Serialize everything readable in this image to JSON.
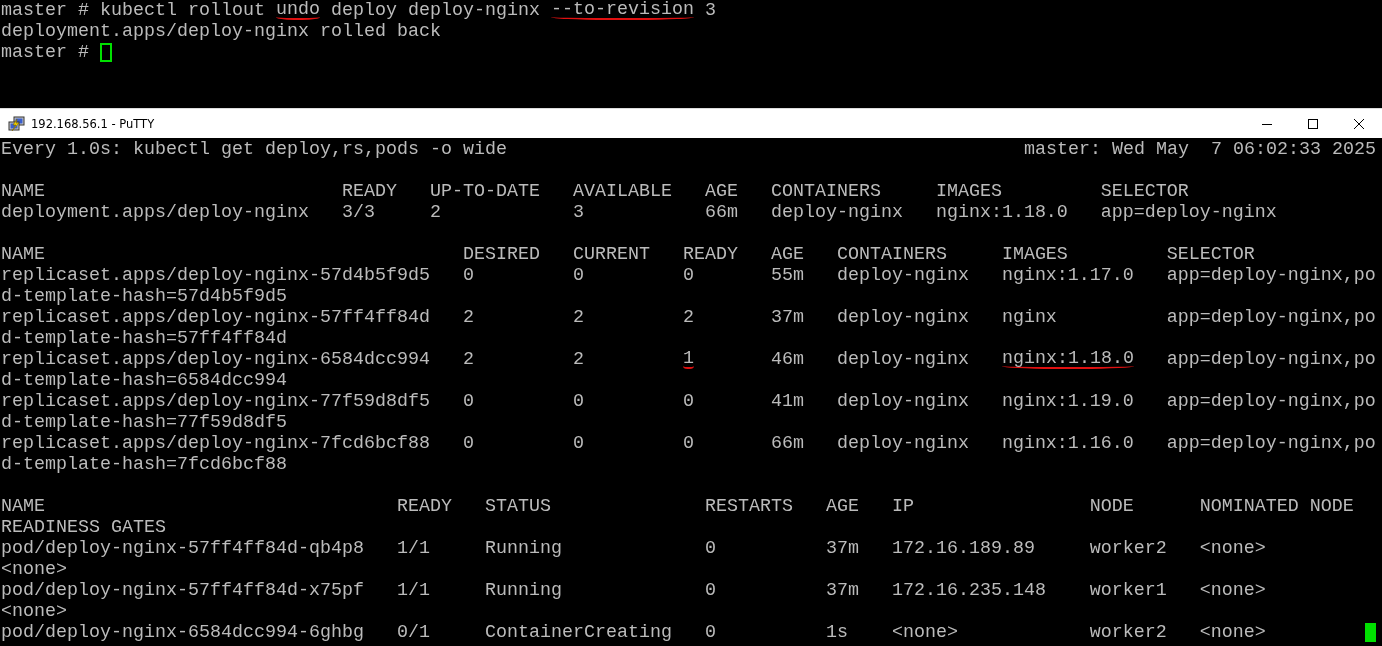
{
  "upper_terminal": {
    "lines": [
      {
        "parts": [
          {
            "text": "master # kubectl rollout ",
            "underlined": false
          },
          {
            "text": "undo",
            "underlined": true
          },
          {
            "text": " deploy deploy-nginx ",
            "underlined": false
          },
          {
            "text": "--to-revision",
            "underlined": true
          },
          {
            "text": " 3",
            "underlined": false
          }
        ]
      },
      {
        "text": "deployment.apps/deploy-nginx rolled back"
      },
      {
        "text": "master # ",
        "cursor": {
          "kind": "hollow"
        }
      }
    ]
  },
  "window": {
    "title": "192.168.56.1 - PuTTY"
  },
  "terminal": {
    "header_left": "Every 1.0s: kubectl get deploy,rs,pods -o wide",
    "header_right": "master: Wed May  7 06:02:33 2025",
    "sections": [
      {
        "lines": [
          {
            "text": "NAME                           READY   UP-TO-DATE   AVAILABLE   AGE   CONTAINERS     IMAGES         SELECTOR"
          },
          {
            "text": "deployment.apps/deploy-nginx   3/3     2            3           66m   deploy-nginx   nginx:1.18.0   app=deploy-nginx"
          }
        ]
      },
      {
        "lines": [
          {
            "text": "NAME                                      DESIRED   CURRENT   READY   AGE   CONTAINERS     IMAGES         SELECTOR"
          },
          {
            "text": "replicaset.apps/deploy-nginx-57d4b5f9d5   0         0         0       55m   deploy-nginx   nginx:1.17.0   app=deploy-nginx,po"
          },
          {
            "text": "d-template-hash=57d4b5f9d5"
          },
          {
            "text": "replicaset.apps/deploy-nginx-57ff4ff84d   2         2         2       37m   deploy-nginx   nginx          app=deploy-nginx,po"
          },
          {
            "text": "d-template-hash=57ff4ff84d"
          },
          {
            "parts": [
              {
                "text": "replicaset.apps/deploy-nginx-6584dcc994   2         2         ",
                "underlined": false
              },
              {
                "text": "1",
                "underlined": true
              },
              {
                "text": "       46m   deploy-nginx   ",
                "underlined": false
              },
              {
                "text": "nginx:1.18.0",
                "underlined": true
              },
              {
                "text": "   app=deploy-nginx,po",
                "underlined": false
              }
            ]
          },
          {
            "text": "d-template-hash=6584dcc994"
          },
          {
            "text": "replicaset.apps/deploy-nginx-77f59d8df5   0         0         0       41m   deploy-nginx   nginx:1.19.0   app=deploy-nginx,po"
          },
          {
            "text": "d-template-hash=77f59d8df5"
          },
          {
            "text": "replicaset.apps/deploy-nginx-7fcd6bcf88   0         0         0       66m   deploy-nginx   nginx:1.16.0   app=deploy-nginx,po"
          },
          {
            "text": "d-template-hash=7fcd6bcf88"
          }
        ]
      },
      {
        "lines": [
          {
            "text": "NAME                                READY   STATUS              RESTARTS   AGE   IP                NODE      NOMINATED NODE"
          },
          {
            "text": "READINESS GATES"
          },
          {
            "text": "pod/deploy-nginx-57ff4ff84d-qb4p8   1/1     Running             0          37m   172.16.189.89     worker2   <none>"
          },
          {
            "text": "<none>"
          },
          {
            "text": "pod/deploy-nginx-57ff4ff84d-x75pf   1/1     Running             0          37m   172.16.235.148    worker1   <none>"
          },
          {
            "text": "<none>"
          },
          {
            "text": "pod/deploy-nginx-6584dcc994-6ghbg   0/1     ContainerCreating   0          1s    <none>            worker2   <none>",
            "cursor": {
              "kind": "block"
            }
          }
        ]
      }
    ]
  }
}
